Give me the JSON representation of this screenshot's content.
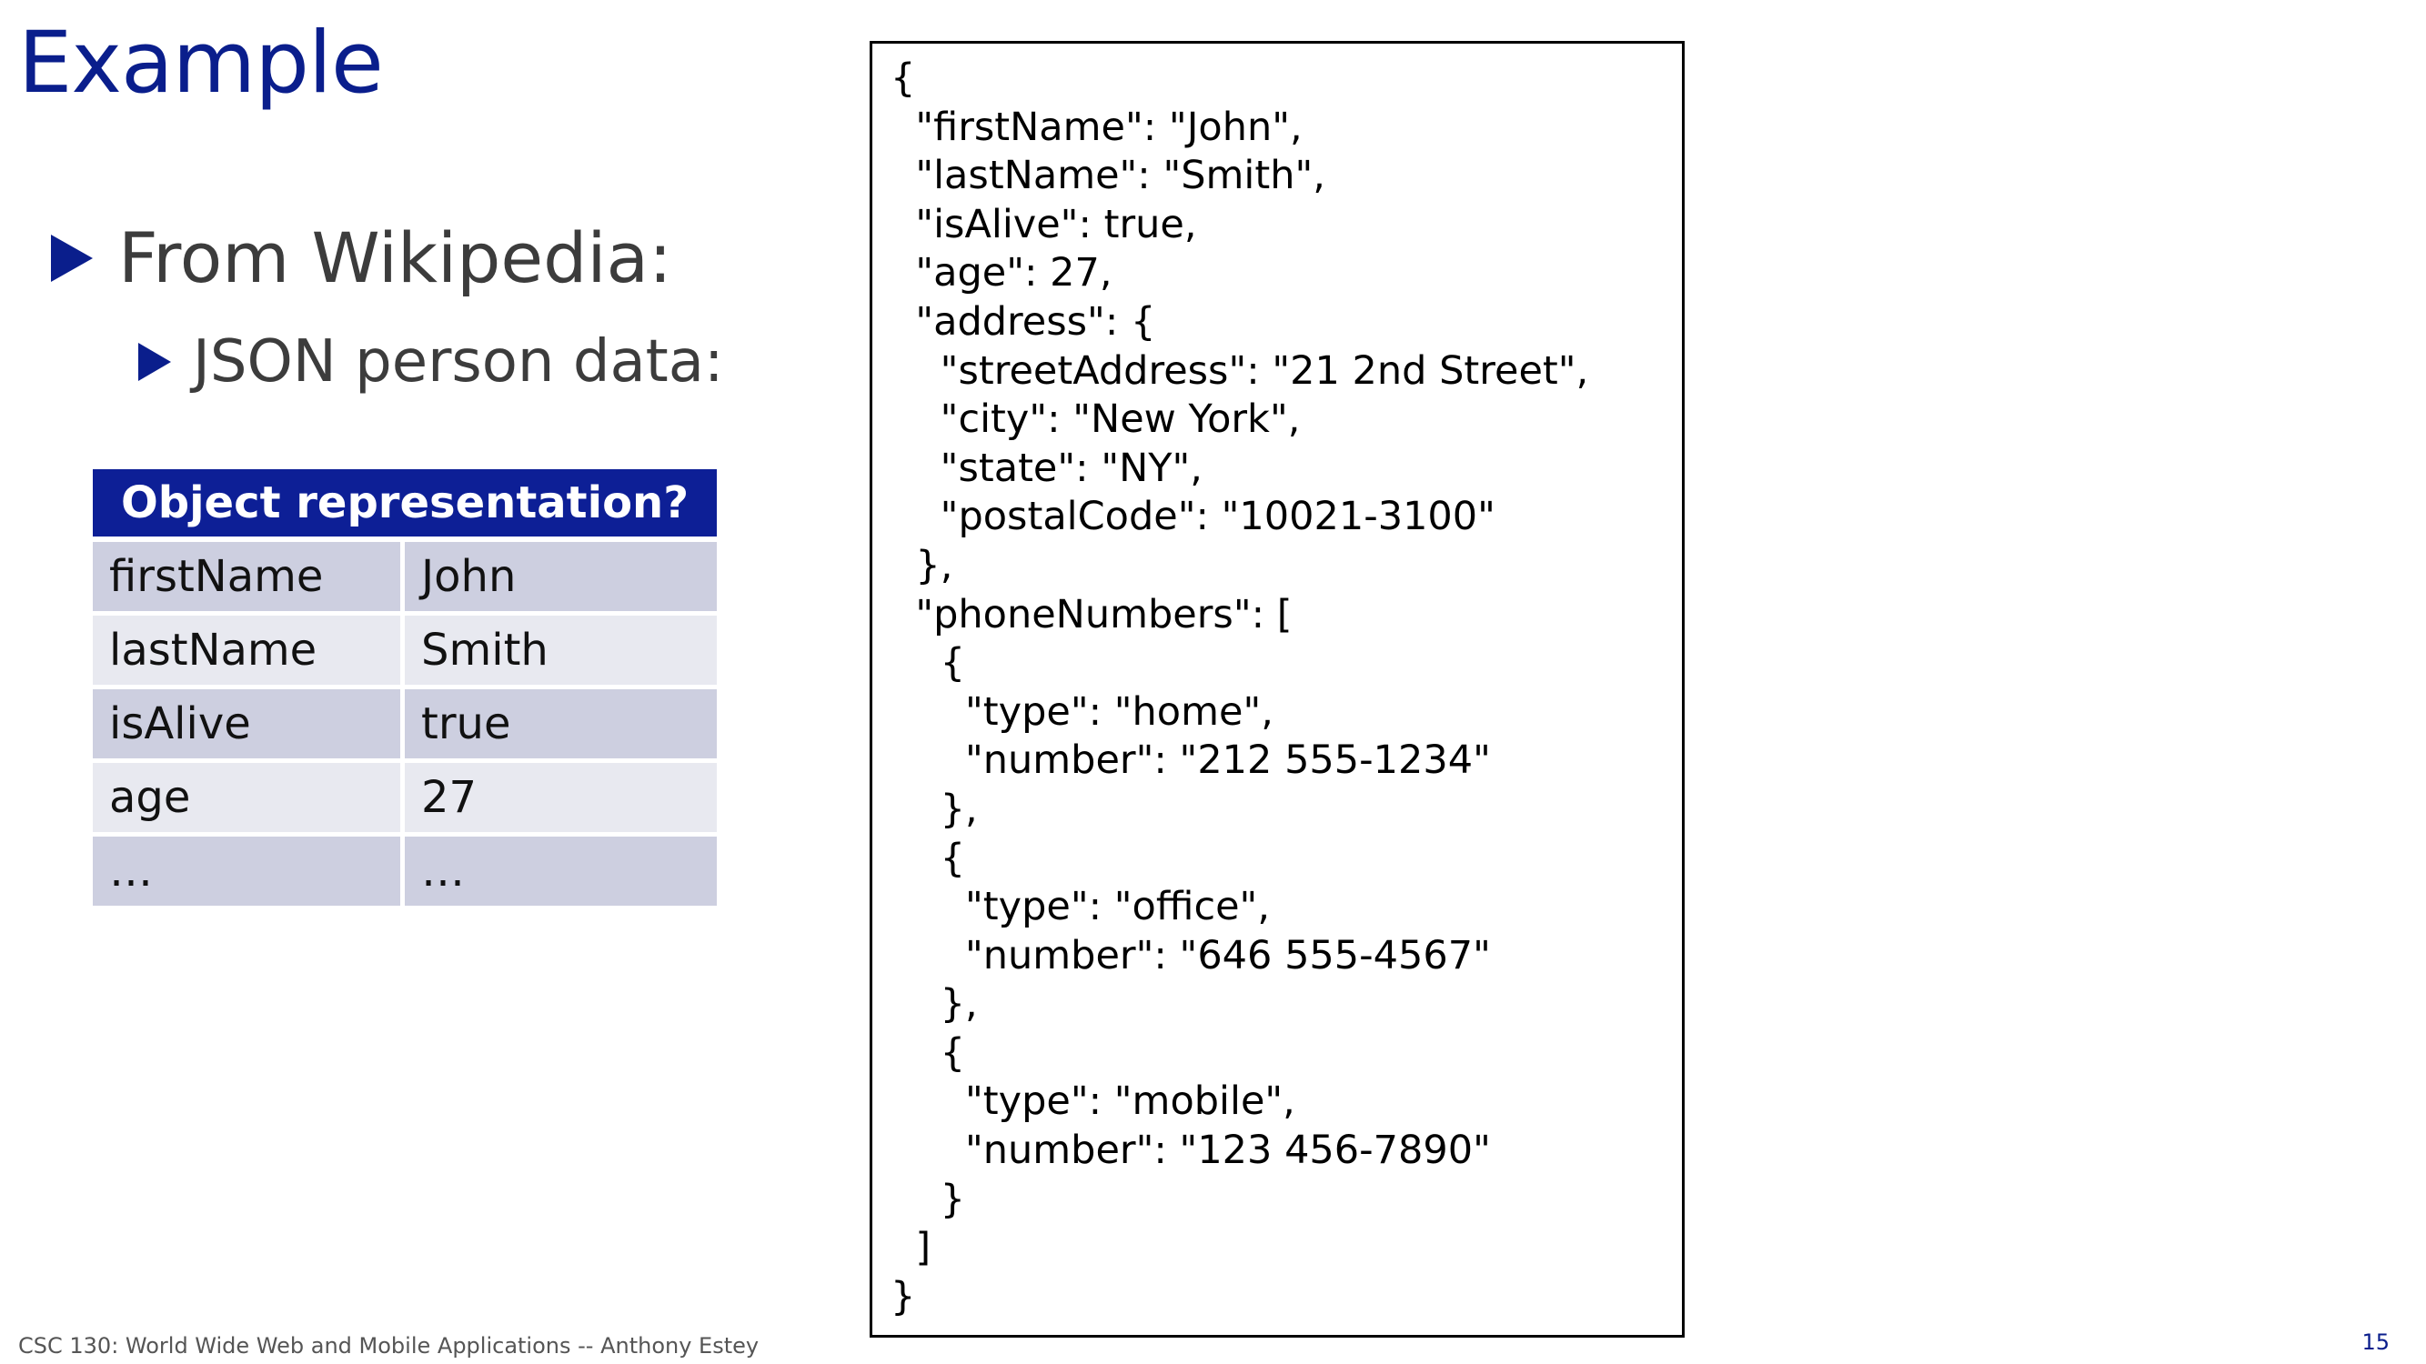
{
  "slide": {
    "title": "Example",
    "bullets": [
      {
        "text": "From Wikipedia:"
      },
      {
        "text": "JSON person data:"
      }
    ],
    "table": {
      "header": "Object representation?",
      "rows": [
        {
          "key": "firstName",
          "value": "John"
        },
        {
          "key": "lastName",
          "value": "Smith"
        },
        {
          "key": "isAlive",
          "value": "true"
        },
        {
          "key": "age",
          "value": "27"
        },
        {
          "key": "…",
          "value": "…"
        }
      ]
    },
    "json_code": "{\n  \"firstName\": \"John\",\n  \"lastName\": \"Smith\",\n  \"isAlive\": true,\n  \"age\": 27,\n  \"address\": {\n    \"streetAddress\": \"21 2nd Street\",\n    \"city\": \"New York\",\n    \"state\": \"NY\",\n    \"postalCode\": \"10021-3100\"\n  },\n  \"phoneNumbers\": [\n    {\n      \"type\": \"home\",\n      \"number\": \"212 555-1234\"\n    },\n    {\n      \"type\": \"office\",\n      \"number\": \"646 555-4567\"\n    },\n    {\n      \"type\": \"mobile\",\n      \"number\": \"123 456-7890\"\n    }\n  ]\n}",
    "footer": "CSC 130: World Wide Web and Mobile Applications -- Anthony Estey",
    "page_number": "15"
  },
  "colors": {
    "title": "#0a1e8c",
    "table_header_bg": "#0d1f96",
    "row_dark": "#cdcfe0",
    "row_light": "#e8e9f0"
  },
  "icons": {
    "bullet": "triangle-right-icon"
  }
}
